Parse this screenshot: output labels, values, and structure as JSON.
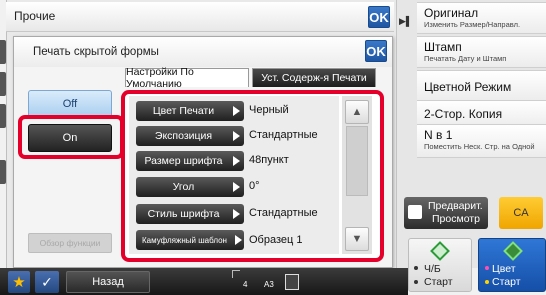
{
  "outer": {
    "title": "Прочие",
    "ok_label": "OK"
  },
  "dialog": {
    "title": "Печать скрытой формы",
    "ok_label": "OK",
    "tabs": [
      "Настройки По Умолчанию",
      "Уст. Содерж-я Печати"
    ],
    "toggle": {
      "off_label": "Off",
      "on_label": "On",
      "selected": "On"
    },
    "preview_func_label": "Обзор функции",
    "settings": [
      {
        "label": "Цвет Печати",
        "value": "Черный"
      },
      {
        "label": "Экспозиция",
        "value": "Стандартные"
      },
      {
        "label": "Размер шрифта",
        "value": "48пункт"
      },
      {
        "label": "Угол",
        "value": "0°"
      },
      {
        "label": "Стиль шрифта",
        "value": "Стандартные"
      },
      {
        "label": "Камуфляжный шаблон",
        "value": "Образец 1"
      }
    ]
  },
  "right_panel": {
    "items": [
      {
        "main": "Оригинал",
        "sub": "Изменить Размер/Направл."
      },
      {
        "main": "Штамп",
        "sub": "Печатать Дату и Штамп"
      },
      {
        "main": "Цветной Режим",
        "sub": ""
      },
      {
        "main": "2-Стор. Копия",
        "sub": ""
      },
      {
        "main": "N в 1",
        "sub": "Поместить Неск. Стр. на Одной"
      }
    ],
    "preview_line1": "Предварит.",
    "preview_line2": "Просмотр",
    "ca_label": "CA",
    "bw_start_line1": "Ч/Б",
    "bw_start_line2": "Старт",
    "color_start_line1": "Цвет",
    "color_start_line2": "Старт"
  },
  "bottom_bar": {
    "back_label": "Назад",
    "paper_tray": "4",
    "paper_size": "A3"
  },
  "colors": {
    "highlight_red": "#e4002b",
    "ok_blue": "#1f56a3",
    "start_green": "#2d9a3a",
    "ca_yellow": "#f0a500"
  },
  "icons": [
    "star-icon",
    "check-icon",
    "preview-icon",
    "start-diamond-icon",
    "scroll-up-icon",
    "scroll-down-icon",
    "arrow-right-icon"
  ]
}
